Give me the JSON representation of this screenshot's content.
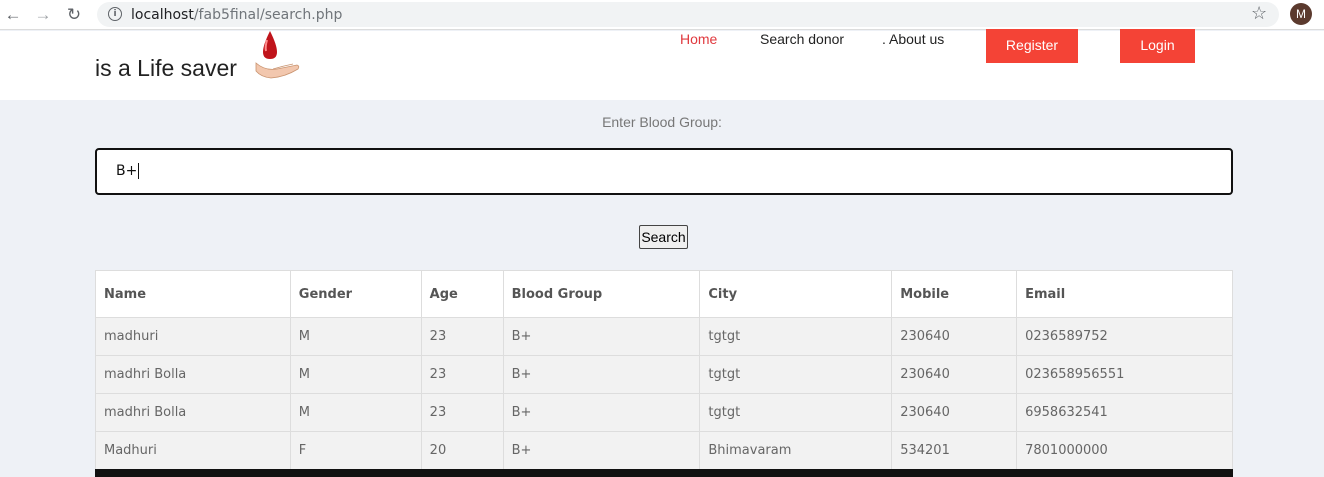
{
  "browser": {
    "url_host": "localhost",
    "url_path": "/fab5final/search.php",
    "avatar_initial": "M"
  },
  "header": {
    "tagline": "is a Life saver",
    "nav": {
      "home": "Home",
      "search": "Search donor",
      "about": ". About us",
      "register": "Register",
      "login": "Login"
    },
    "colors": {
      "accent": "#f44336",
      "active_link": "#e0393e"
    }
  },
  "search": {
    "label": "Enter Blood Group:",
    "value": "B+",
    "button": "Search"
  },
  "table": {
    "headers": [
      "Name",
      "Gender",
      "Age",
      "Blood Group",
      "City",
      "Mobile",
      "Email"
    ],
    "rows": [
      [
        "madhuri",
        "M",
        "23",
        "B+",
        "tgtgt",
        "230640",
        "0236589752"
      ],
      [
        "madhri Bolla",
        "M",
        "23",
        "B+",
        "tgtgt",
        "230640",
        "023658956551"
      ],
      [
        "madhri Bolla",
        "M",
        "23",
        "B+",
        "tgtgt",
        "230640",
        "6958632541"
      ],
      [
        "Madhuri",
        "F",
        "20",
        "B+",
        "Bhimavaram",
        "534201",
        "7801000000"
      ]
    ]
  }
}
